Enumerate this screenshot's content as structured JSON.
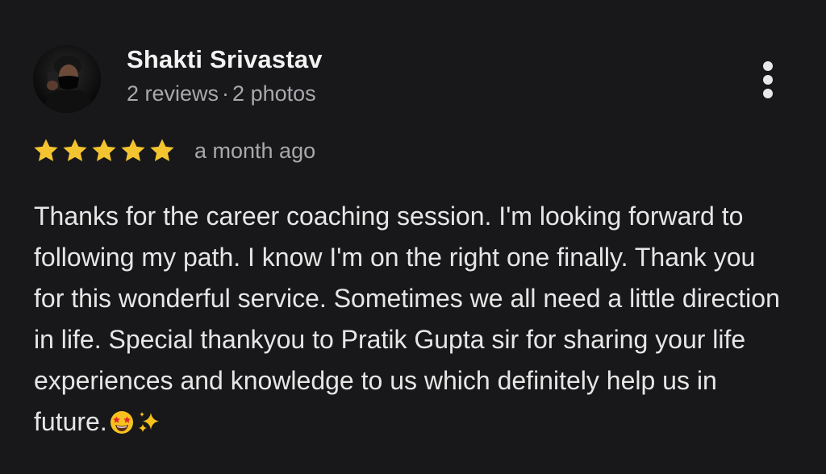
{
  "reviewer": {
    "name": "Shakti Srivastav",
    "reviews": "2 reviews",
    "separator": "·",
    "photos": "2 photos"
  },
  "rating": {
    "stars": 5,
    "max": 5,
    "star_color": "#f4c430"
  },
  "review": {
    "time": "a month ago",
    "text": "Thanks for the career coaching session. I'm looking forward to following my path. I know I'm on the right one finally. Thank you for this wonderful service. Sometimes we all need a little direction in life. Special thankyou to Pratik Gupta sir for sharing your life experiences and knowledge to us which definitely help us in future.",
    "emojis": [
      "star-struck-emoji",
      "sparkles-emoji"
    ]
  },
  "icons": {
    "more": "more-vert-icon",
    "avatar": "avatar-photo"
  },
  "colors": {
    "background": "#18181a",
    "primary_text": "#f2f2f2",
    "secondary_text": "#a9a9ad"
  }
}
